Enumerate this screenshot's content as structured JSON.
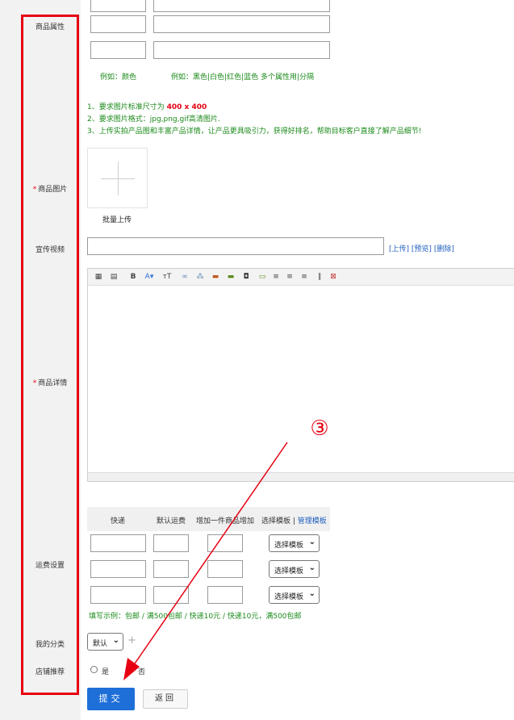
{
  "labels": {
    "attributes": "商品属性",
    "images": "商品图片",
    "video": "宣传视频",
    "details": "商品详情",
    "shipping": "运费设置",
    "category": "我的分类",
    "recommend": "店铺推荐"
  },
  "required_mark": "*",
  "attribute_examples": {
    "name": "例如：颜色",
    "value": "例如：黑色|白色|红色|蓝色 多个属性用|分隔"
  },
  "image_notes": {
    "line1_prefix": "1、要求图片标准尺寸为 ",
    "line1_size": "400 x 400",
    "line2": "2、要求图片格式：jpg,png,gif高清图片.",
    "line3": "3、上传实拍产品图和丰富产品详情，让产品更具吸引力，获得好排名，帮助目标客户直接了解产品细节!"
  },
  "batch_upload": "批量上传",
  "video_links": {
    "upload": "[上传]",
    "preview": "[预览]",
    "delete": "[删除]"
  },
  "editor_toolbar_icons": [
    "paste-icon",
    "paste-text-icon",
    "bold-icon",
    "font-color-icon",
    "font-size-icon",
    "link-icon",
    "unlink-icon",
    "image-icon",
    "multi-image-icon",
    "video-icon",
    "table-icon",
    "align-left-icon",
    "align-center-icon",
    "align-right-icon",
    "attachment-icon",
    "fullscreen-icon"
  ],
  "shipping": {
    "headers": {
      "express": "快递",
      "default_fee": "默认运费",
      "add_fee": "增加一件商品增加",
      "template_select": "选择模板",
      "separator": " | ",
      "template_manage": "管理模板"
    },
    "select_label": "选择模板",
    "example": "填写示例：包邮 / 满500包邮 / 快递10元 / 快递10元，满500包邮"
  },
  "category": {
    "selected": "默认",
    "add_icon": "+"
  },
  "recommend": {
    "yes": "是",
    "no": "否"
  },
  "buttons": {
    "submit": "提交",
    "back": "返回"
  },
  "annotation": {
    "step": "③"
  },
  "colors": {
    "accent_red": "#e60012",
    "primary_blue": "#1e6fd8",
    "hint_green": "#1a8a1a"
  }
}
